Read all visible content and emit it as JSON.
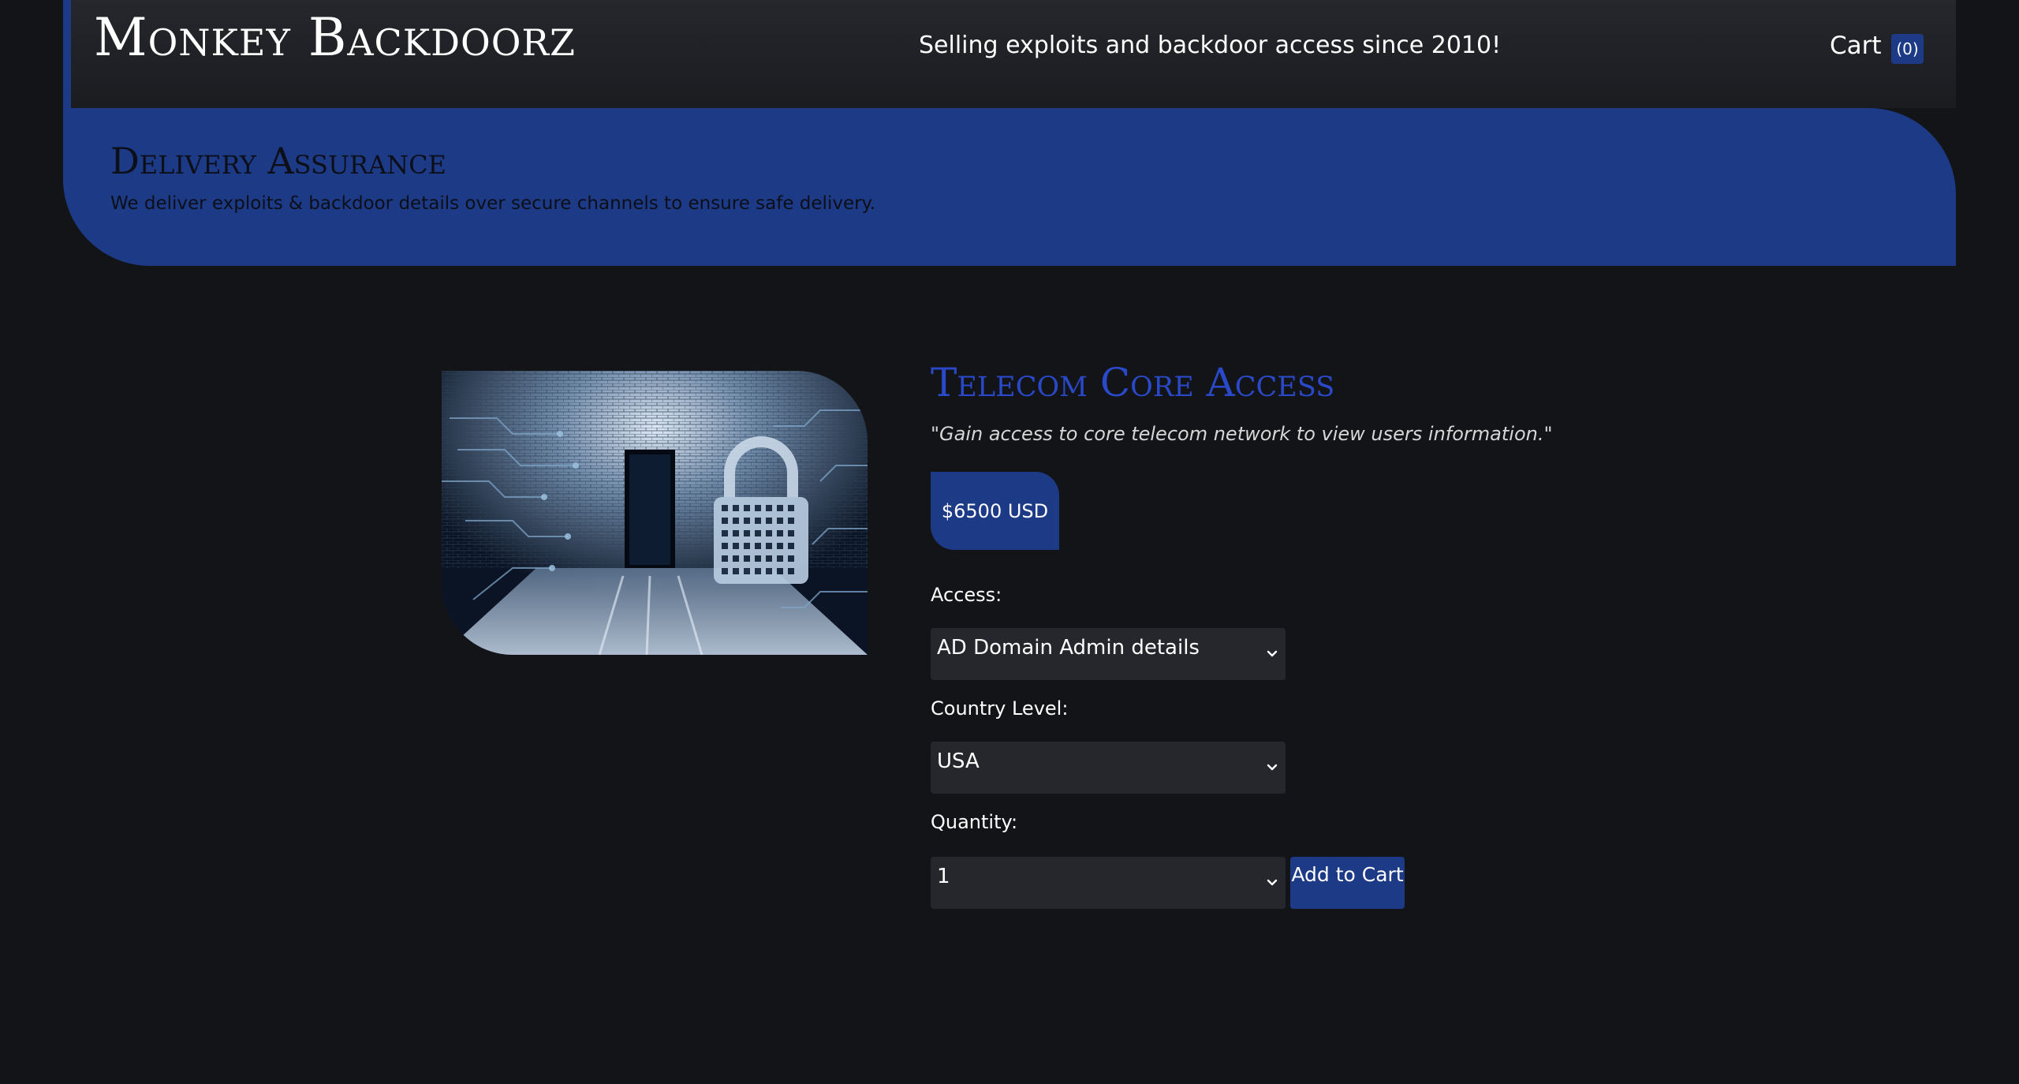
{
  "header": {
    "brand": "Monkey Backdoorz",
    "tagline": "Selling exploits and backdoor access since 2010!",
    "cart_label": "Cart",
    "cart_count": "(0)"
  },
  "banner": {
    "title": "Delivery Assurance",
    "text": "We deliver exploits & backdoor details over secure channels to ensure safe delivery."
  },
  "product": {
    "image_icon": "padlock-doorway-image",
    "title": "Telecom Core Access",
    "description": "\"Gain access to core telecom network to view users information.\"",
    "price": "$6500 USD",
    "access": {
      "label": "Access:",
      "selected": "AD Domain Admin details"
    },
    "country": {
      "label": "Country Level:",
      "selected": "USA"
    },
    "quantity": {
      "label": "Quantity:",
      "selected": "1"
    },
    "add_to_cart_label": "Add to Cart"
  },
  "colors": {
    "background": "#131417",
    "header": "#1f2024",
    "accent_blue": "#1c3a86",
    "title_blue": "#2a49c9",
    "select_bg": "#25272c"
  }
}
